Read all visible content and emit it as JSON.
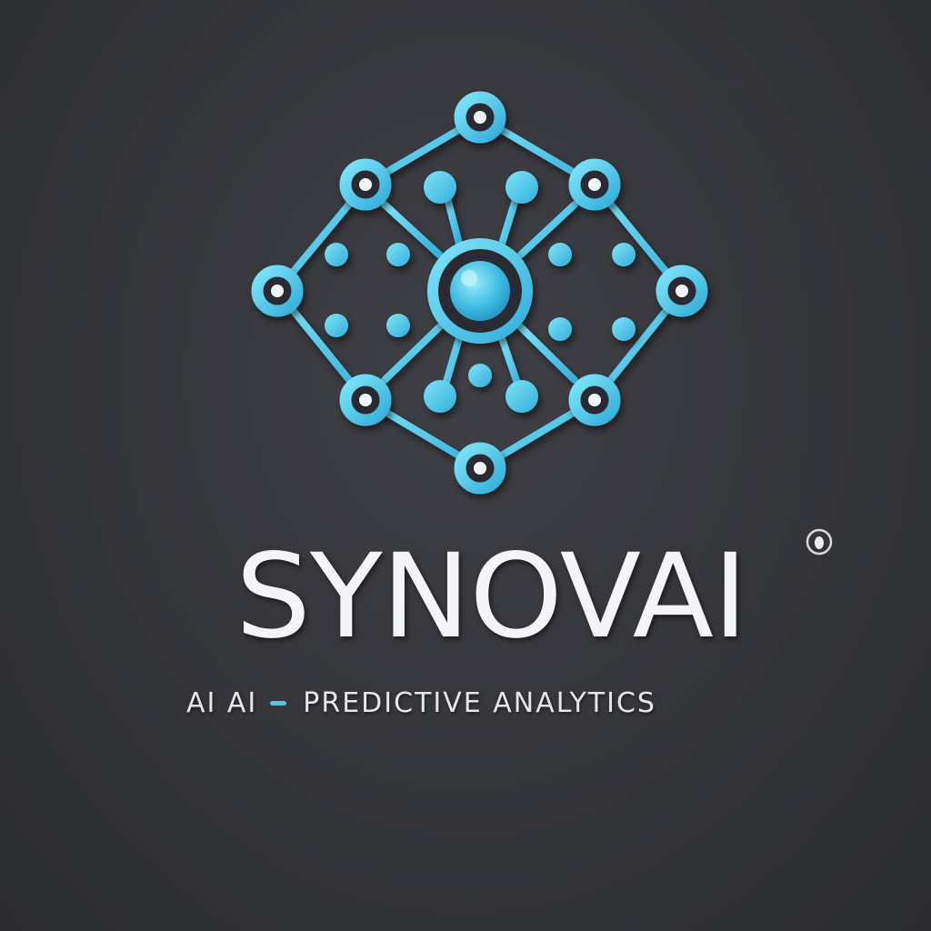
{
  "brand": {
    "name": "SYNOVAI",
    "tagline_part1": "AI AI",
    "tagline_part2": "PREDICTIVE ANALYTICS"
  },
  "colors": {
    "background": "#36373c",
    "accent": "#4fc6e8",
    "text": "#f4f5f7"
  },
  "icons": {
    "logo": "neural-network-icon",
    "trademark": "registered-mark-icon"
  }
}
